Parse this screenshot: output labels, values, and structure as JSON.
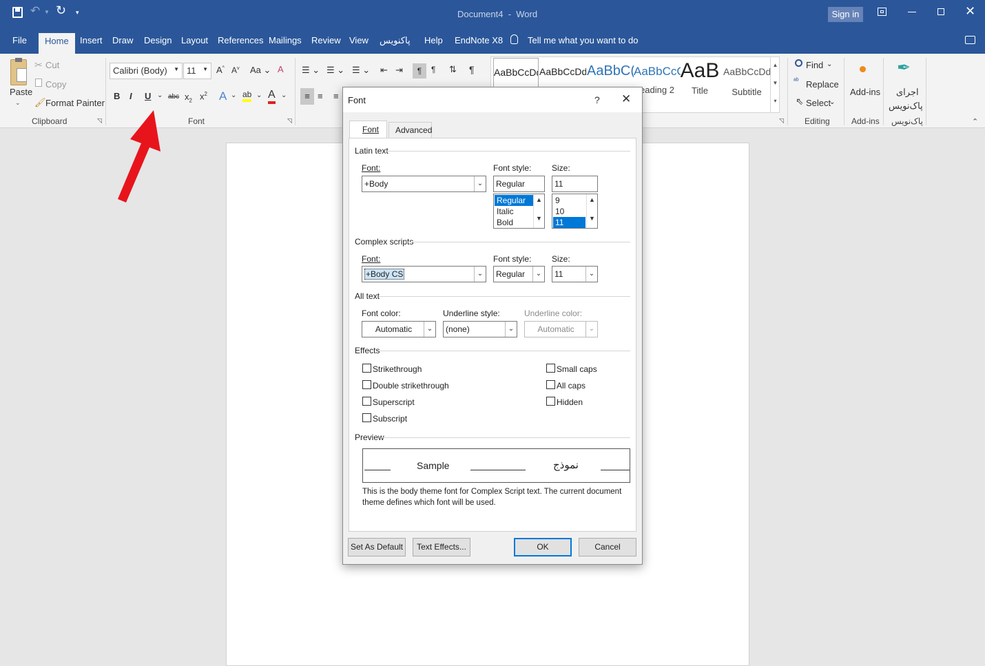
{
  "titlebar": {
    "title": "Document4  -  Word",
    "sign_in": "Sign in"
  },
  "tabs": [
    "File",
    "Home",
    "Insert",
    "Draw",
    "Design",
    "Layout",
    "References",
    "Mailings",
    "Review",
    "View",
    "پاکنویس",
    "Help",
    "EndNote X8"
  ],
  "tell_me": "Tell me what you want to do",
  "clipboard": {
    "paste": "Paste",
    "cut": "Cut",
    "copy": "Copy",
    "format_painter": "Format Painter",
    "label": "Clipboard"
  },
  "font_group": {
    "font_name": "Calibri (Body)",
    "font_size": "11",
    "label": "Font"
  },
  "styles": [
    {
      "preview": "AaBbCcDd",
      "name": ""
    },
    {
      "preview": "AaBbCcDd",
      "name": ""
    },
    {
      "preview": "AaBbC(",
      "name": ""
    },
    {
      "preview": "AaBbCcC",
      "name": "eading 2"
    },
    {
      "preview": "AaB",
      "name": "Title"
    },
    {
      "preview": "AaBbCcDd",
      "name": "Subtitle"
    }
  ],
  "editing": {
    "find": "Find",
    "replace": "Replace",
    "select": "Select",
    "label": "Editing"
  },
  "addins": {
    "addins": "Add-ins",
    "label": "Add-ins"
  },
  "paknevis": {
    "run_line1": "اجرای",
    "run_line2": "پاک‌نویس",
    "label": "پاک‌نویس"
  },
  "arrow_color": "#e8141c",
  "accent_color": "#2b579a",
  "dialog": {
    "title": "Font",
    "help": "?",
    "tabs": [
      "Font",
      "Advanced"
    ],
    "latin_text": "Latin text",
    "font_label": "Font:",
    "font_style_label": "Font style:",
    "size_label": "Size:",
    "latin_font": "+Body",
    "latin_style": "Regular",
    "latin_size": "11",
    "style_list": [
      "Regular",
      "Italic",
      "Bold"
    ],
    "size_list": [
      "9",
      "10",
      "11"
    ],
    "complex_scripts": "Complex scripts",
    "cs_font": "+Body CS",
    "cs_style": "Regular",
    "cs_size": "11",
    "all_text": "All text",
    "font_color_label": "Font color:",
    "underline_style_label": "Underline style:",
    "underline_color_label": "Underline color:",
    "font_color": "Automatic",
    "underline_style": "(none)",
    "underline_color": "Automatic",
    "effects": "Effects",
    "effects_left": [
      "Strikethrough",
      "Double strikethrough",
      "Superscript",
      "Subscript"
    ],
    "effects_right": [
      "Small caps",
      "All caps",
      "Hidden"
    ],
    "preview": "Preview",
    "preview_sample": "Sample",
    "preview_sample_cs": "نموذج",
    "description": "This is the body theme font for Complex Script text. The current document theme defines which font will be used.",
    "set_default": "Set As Default",
    "text_effects": "Text Effects...",
    "ok": "OK",
    "cancel": "Cancel"
  }
}
